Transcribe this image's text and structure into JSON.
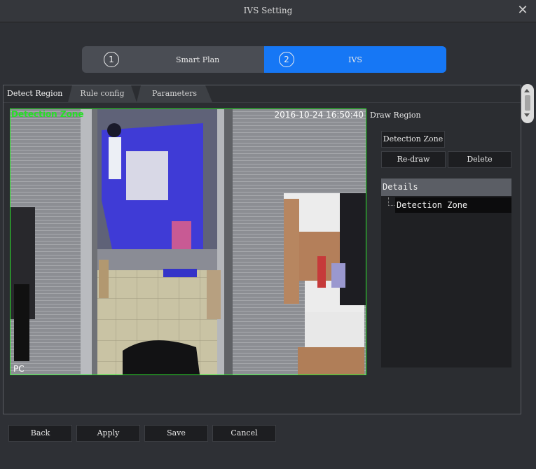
{
  "window": {
    "title": "IVS Setting",
    "close_icon": "close-icon"
  },
  "steps": [
    {
      "number": "1",
      "label": "Smart Plan",
      "active": false
    },
    {
      "number": "2",
      "label": "IVS",
      "active": true
    }
  ],
  "tabs": [
    {
      "label": "Detect Region",
      "active": true
    },
    {
      "label": "Rule config",
      "active": false
    },
    {
      "label": "Parameters",
      "active": false
    }
  ],
  "video": {
    "zone_label": "Detection Zone",
    "timestamp": "2016-10-24 16:50:40",
    "corner_text": "PC"
  },
  "draw_region": {
    "label": "Draw Region",
    "zone_button": "Detection Zone",
    "redraw_button": "Re-draw",
    "delete_button": "Delete"
  },
  "details": {
    "header": "Details",
    "items": [
      "Detection Zone"
    ]
  },
  "footer": {
    "back": "Back",
    "apply": "Apply",
    "save": "Save",
    "cancel": "Cancel"
  },
  "colors": {
    "accent": "#1677f5",
    "zone_border": "#2ee62e",
    "background": "#2e3035"
  }
}
